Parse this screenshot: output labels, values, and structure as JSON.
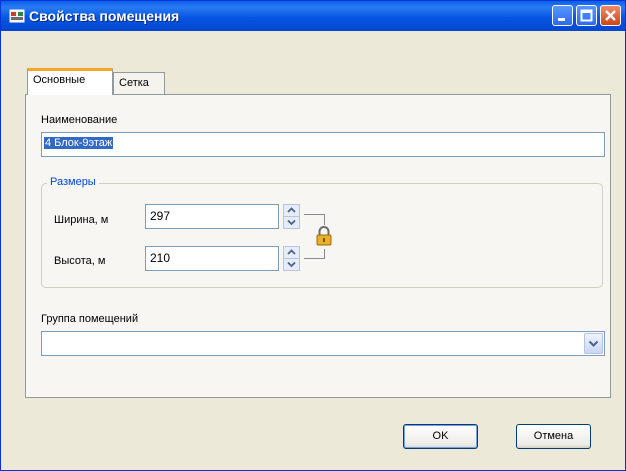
{
  "window": {
    "title": "Свойства помещения",
    "controls": [
      "minimize-icon",
      "maximize-icon",
      "close-icon"
    ]
  },
  "tabs": [
    {
      "label": "Основные",
      "active": true
    },
    {
      "label": "Сетка",
      "active": false
    }
  ],
  "general": {
    "name_label": "Наименование",
    "name_value": "4 Блок-9этаж",
    "size_group": {
      "legend": "Размеры",
      "width_label": "Ширина, м",
      "width_value": "297",
      "height_label": "Высота, м",
      "height_value": "210",
      "lock_icon": "padlock-icon"
    },
    "room_group_label": "Группа помещений",
    "room_group_value": ""
  },
  "buttons": {
    "ok": "OK",
    "cancel": "Отмена"
  }
}
